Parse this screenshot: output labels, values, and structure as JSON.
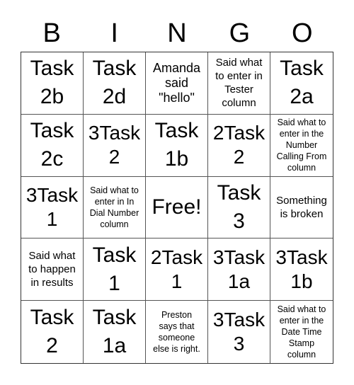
{
  "header": {
    "letters": [
      "B",
      "I",
      "N",
      "G",
      "O"
    ]
  },
  "cells": [
    {
      "text": "Task\n2b",
      "size": "xl"
    },
    {
      "text": "Task\n2d",
      "size": "xl"
    },
    {
      "text": "Amanda\nsaid\n\"hello\"",
      "size": "m"
    },
    {
      "text": "Said what\nto enter in\nTester\ncolumn",
      "size": "s"
    },
    {
      "text": "Task\n2a",
      "size": "xl"
    },
    {
      "text": "Task\n2c",
      "size": "xl"
    },
    {
      "text": "3Task\n2",
      "size": "l"
    },
    {
      "text": "Task\n1b",
      "size": "xl"
    },
    {
      "text": "2Task\n2",
      "size": "l"
    },
    {
      "text": "Said what to\nenter in the\nNumber\nCalling From\ncolumn",
      "size": "xs"
    },
    {
      "text": "3Task\n1",
      "size": "l"
    },
    {
      "text": "Said what to\nenter in In\nDial Number\ncolumn",
      "size": "xs"
    },
    {
      "text": "Free!",
      "size": "free"
    },
    {
      "text": "Task\n3",
      "size": "xl"
    },
    {
      "text": "Something\nis broken",
      "size": "s"
    },
    {
      "text": "Said what\nto happen\nin results",
      "size": "s"
    },
    {
      "text": "Task\n1",
      "size": "xl"
    },
    {
      "text": "2Task\n1",
      "size": "l"
    },
    {
      "text": "3Task\n1a",
      "size": "l"
    },
    {
      "text": "3Task\n1b",
      "size": "l"
    },
    {
      "text": "Task\n2",
      "size": "xl"
    },
    {
      "text": "Task\n1a",
      "size": "xl"
    },
    {
      "text": "Preston\nsays that\nsomeone\nelse is right.",
      "size": "xs"
    },
    {
      "text": "3Task\n3",
      "size": "l"
    },
    {
      "text": "Said what to\nenter in the\nDate Time\nStamp\ncolumn",
      "size": "xs"
    }
  ]
}
